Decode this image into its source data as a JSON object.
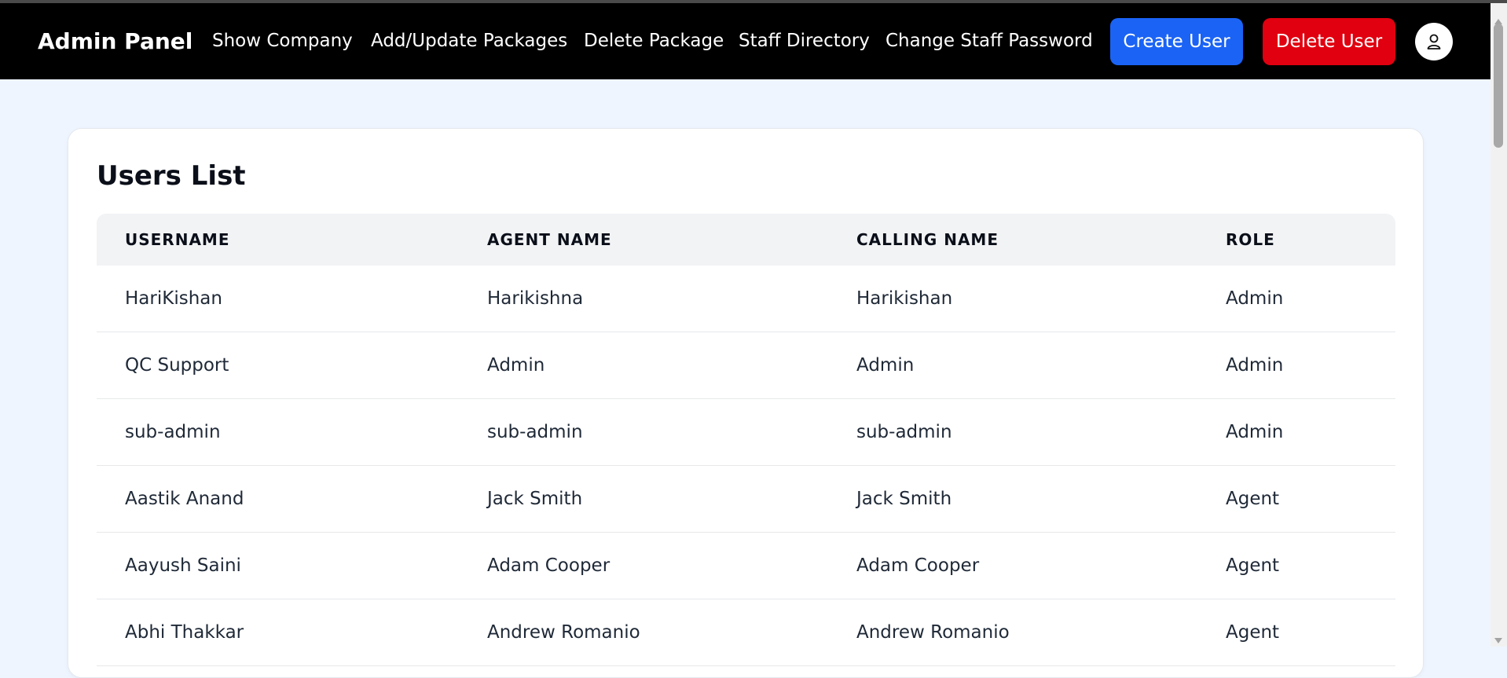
{
  "navbar": {
    "brand": "Admin Panel",
    "links": [
      "Show Company",
      "Add/Update Packages",
      "Delete Package",
      "Staff Directory",
      "Change Staff Password"
    ],
    "create_user": "Create User",
    "delete_user": "Delete User"
  },
  "users": {
    "title": "Users List",
    "columns": [
      "USERNAME",
      "AGENT NAME",
      "CALLING NAME",
      "ROLE"
    ],
    "rows": [
      [
        "HariKishan",
        "Harikishna",
        "Harikishan",
        "Admin"
      ],
      [
        "QC Support",
        "Admin",
        "Admin",
        "Admin"
      ],
      [
        "sub-admin",
        "sub-admin",
        "sub-admin",
        "Admin"
      ],
      [
        "Aastik Anand",
        "Jack Smith",
        "Jack Smith",
        "Agent"
      ],
      [
        "Aayush Saini",
        "Adam Cooper",
        "Adam Cooper",
        "Agent"
      ],
      [
        "Abhi Thakkar",
        "Andrew Romanio",
        "Andrew Romanio",
        "Agent"
      ]
    ]
  },
  "colors": {
    "create": "#1a63f5",
    "delete": "#e0000f",
    "navbar": "#000000",
    "page_bg": "#eef5ff"
  },
  "icons": {
    "avatar": "user-icon"
  }
}
